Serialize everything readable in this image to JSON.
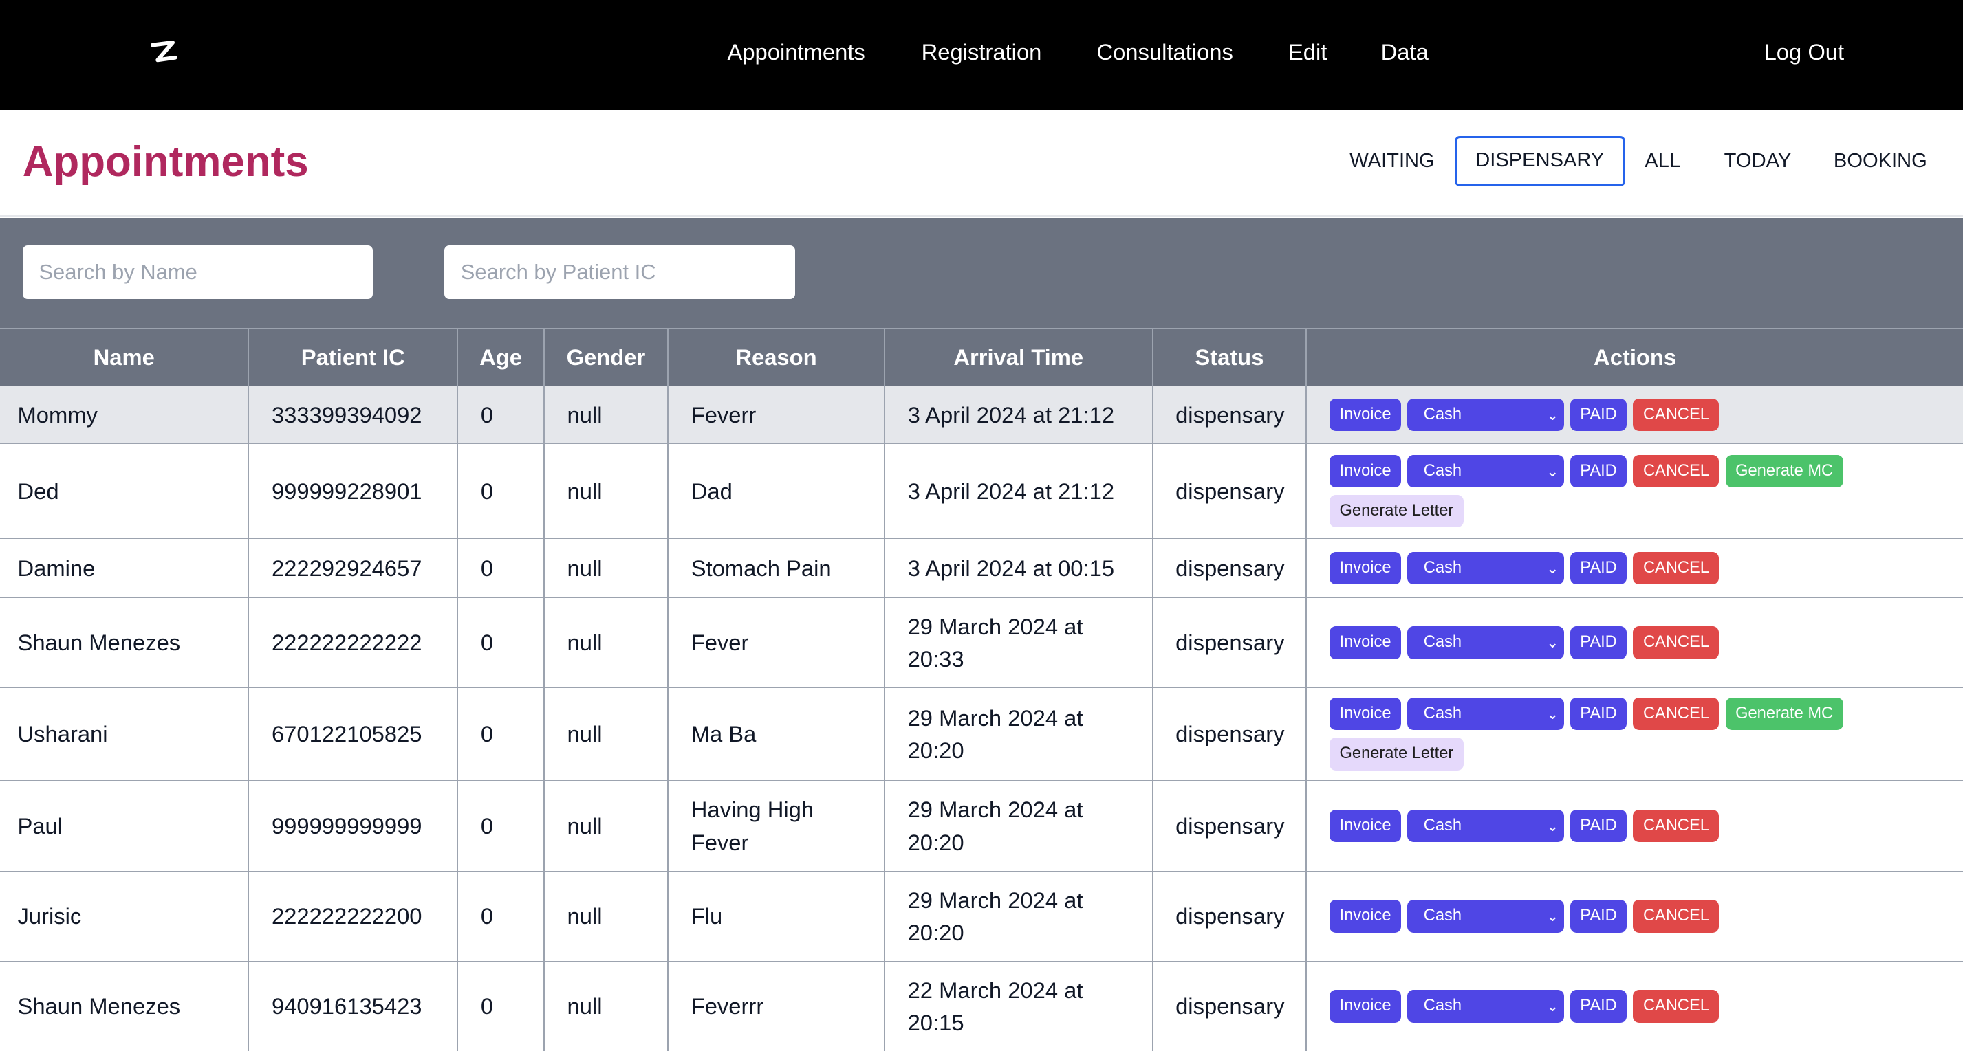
{
  "nav": {
    "links": [
      "Appointments",
      "Registration",
      "Consultations",
      "Edit",
      "Data"
    ],
    "logout": "Log Out"
  },
  "header": {
    "title": "Appointments",
    "tabs": [
      "WAITING",
      "DISPENSARY",
      "ALL",
      "TODAY",
      "BOOKING"
    ],
    "active_tab": "DISPENSARY"
  },
  "search": {
    "name_placeholder": "Search by Name",
    "ic_placeholder": "Search by Patient IC"
  },
  "table": {
    "columns": [
      "Name",
      "Patient IC",
      "Age",
      "Gender",
      "Reason",
      "Arrival Time",
      "Status",
      "Actions"
    ],
    "rows": [
      {
        "name": "Mommy",
        "ic": "333399394092",
        "age": "0",
        "gender": "null",
        "reason": "Feverr",
        "arrival": "3 April 2024 at 21:12",
        "status": "dispensary",
        "payment": "Cash",
        "mc": false
      },
      {
        "name": "Ded",
        "ic": "999999228901",
        "age": "0",
        "gender": "null",
        "reason": "Dad",
        "arrival": "3 April 2024 at 21:12",
        "status": "dispensary",
        "payment": "Cash",
        "mc": true
      },
      {
        "name": "Damine",
        "ic": "222292924657",
        "age": "0",
        "gender": "null",
        "reason": "Stomach Pain",
        "arrival": "3 April 2024 at 00:15",
        "status": "dispensary",
        "payment": "Cash",
        "mc": false
      },
      {
        "name": "Shaun Menezes",
        "ic": "222222222222",
        "age": "0",
        "gender": "null",
        "reason": "Fever",
        "arrival": "29 March 2024 at 20:33",
        "status": "dispensary",
        "payment": "Cash",
        "mc": false
      },
      {
        "name": "Usharani",
        "ic": "670122105825",
        "age": "0",
        "gender": "null",
        "reason": "Ma Ba",
        "arrival": "29 March 2024 at 20:20",
        "status": "dispensary",
        "payment": "Cash",
        "mc": true
      },
      {
        "name": "Paul",
        "ic": "999999999999",
        "age": "0",
        "gender": "null",
        "reason": "Having High Fever",
        "arrival": "29 March 2024 at 20:20",
        "status": "dispensary",
        "payment": "Cash",
        "mc": false
      },
      {
        "name": "Jurisic",
        "ic": "222222222200",
        "age": "0",
        "gender": "null",
        "reason": "Flu",
        "arrival": "29 March 2024 at 20:20",
        "status": "dispensary",
        "payment": "Cash",
        "mc": false
      },
      {
        "name": "Shaun Menezes",
        "ic": "940916135423",
        "age": "0",
        "gender": "null",
        "reason": "Feverrr",
        "arrival": "22 March 2024 at 20:15",
        "status": "dispensary",
        "payment": "Cash",
        "mc": false
      }
    ]
  },
  "actions": {
    "invoice": "Invoice",
    "paid": "PAID",
    "cancel": "CANCEL",
    "generate_mc": "Generate MC",
    "generate_letter": "Generate Letter"
  },
  "colors": {
    "title": "#b0285e",
    "nav_bg": "#000000",
    "toolbar_bg": "#6b7280",
    "primary": "#4f46e5",
    "danger": "#e04848",
    "success": "#4cc36a",
    "letter": "#e5d9fb",
    "active_tab_border": "#2563eb"
  },
  "icons": {
    "logo": "z-logo-icon",
    "select_chevron": "chevron-down-icon"
  }
}
